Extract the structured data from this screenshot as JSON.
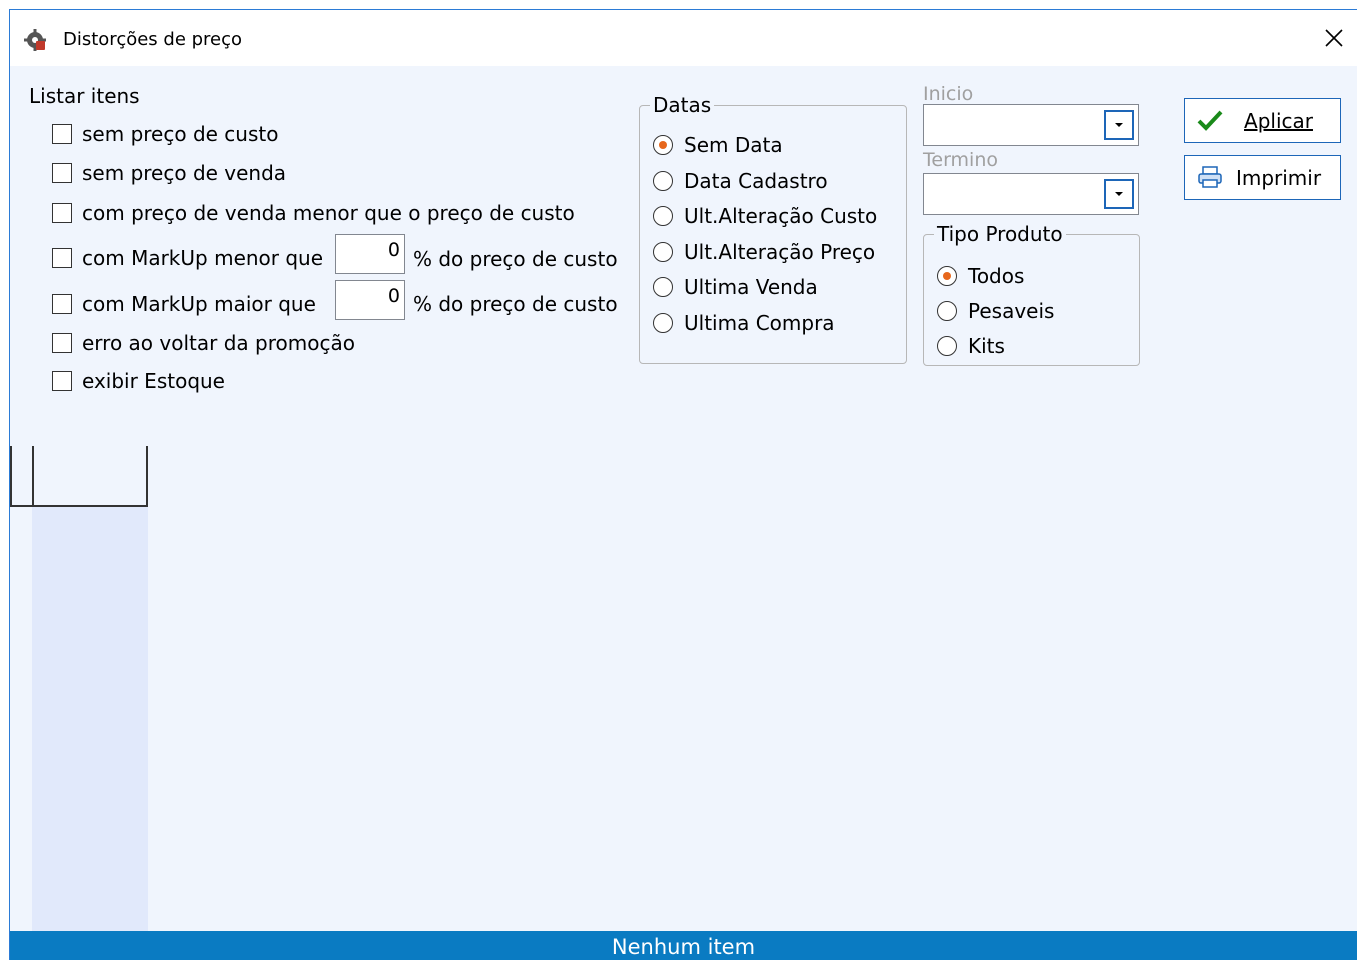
{
  "window": {
    "title": "Distorções de preço",
    "icon": "gear-icon"
  },
  "filters": {
    "section_label": "Listar itens",
    "items": [
      {
        "label": "sem preço de custo"
      },
      {
        "label": "sem preço de venda"
      },
      {
        "label": "com preço de venda menor que o preço de custo"
      },
      {
        "label": "com MarkUp menor que",
        "value": "0",
        "suffix": "% do preço de custo"
      },
      {
        "label": "com MarkUp maior que",
        "value": "0",
        "suffix": "% do preço de custo"
      },
      {
        "label": "erro ao voltar da promoção"
      },
      {
        "label": "exibir Estoque"
      }
    ]
  },
  "datas": {
    "title": "Datas",
    "selected": "Sem Data",
    "options": [
      "Sem Data",
      "Data Cadastro",
      "Ult.Alteração Custo",
      "Ult.Alteração Preço",
      "Ultima Venda",
      "Ultima Compra"
    ]
  },
  "inicio": {
    "label": "Inicio",
    "value": ""
  },
  "termino": {
    "label": "Termino",
    "value": ""
  },
  "tipo_produto": {
    "title": "Tipo Produto",
    "selected": "Todos",
    "options": [
      "Todos",
      "Pesaveis",
      "Kits"
    ]
  },
  "buttons": {
    "apply": "Aplicar",
    "print": "Imprimir"
  },
  "status": {
    "text": "Nenhum item"
  },
  "colors": {
    "accent": "#0a7bc2",
    "border": "#1d66b8",
    "radio_dot": "#e7671c",
    "check": "#1a8a1a"
  }
}
